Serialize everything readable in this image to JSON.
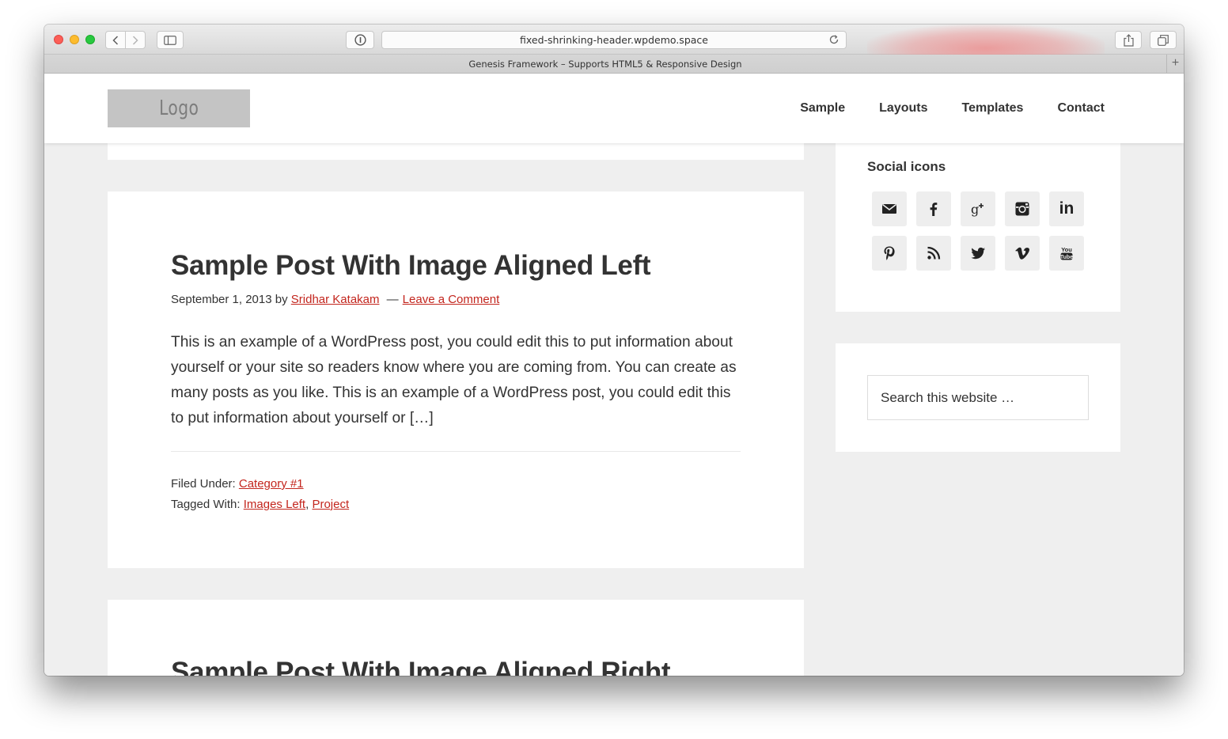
{
  "browser": {
    "url": "fixed-shrinking-header.wpdemo.space",
    "tab_title": "Genesis Framework – Supports HTML5 & Responsive Design",
    "new_tab_symbol": "+"
  },
  "header": {
    "logo_text": "Logo",
    "nav": [
      "Sample",
      "Layouts",
      "Templates",
      "Contact"
    ]
  },
  "posts": [
    {
      "title": "Sample Post With Image Aligned Left",
      "date": "September 1, 2013",
      "by": "by",
      "author": "Sridhar Katakam",
      "separator": "—",
      "comments": "Leave a Comment",
      "excerpt": "This is an example of a WordPress post, you could edit this to put information about yourself or your site so readers know where you are coming from. You can create as many posts as you like. This is an example of a WordPress post, you could edit this to put information about yourself or […]",
      "filed_under_label": "Filed Under:",
      "category": "Category #1",
      "tagged_with_label": "Tagged With:",
      "tags": [
        "Images Left",
        "Project"
      ],
      "tag_separator": ","
    },
    {
      "title": "Sample Post With Image Aligned Right"
    }
  ],
  "sidebar": {
    "social_title": "Social icons",
    "social_icons": [
      "email-icon",
      "facebook-icon",
      "google-plus-icon",
      "instagram-icon",
      "linkedin-icon",
      "pinterest-icon",
      "rss-icon",
      "twitter-icon",
      "vimeo-icon",
      "youtube-icon"
    ],
    "search_placeholder": "Search this website …"
  },
  "colors": {
    "link": "#c3251d",
    "text": "#333333",
    "page_bg": "#efefef",
    "logo_bg": "#c4c4c4",
    "icon_bg": "#eeeeee"
  }
}
